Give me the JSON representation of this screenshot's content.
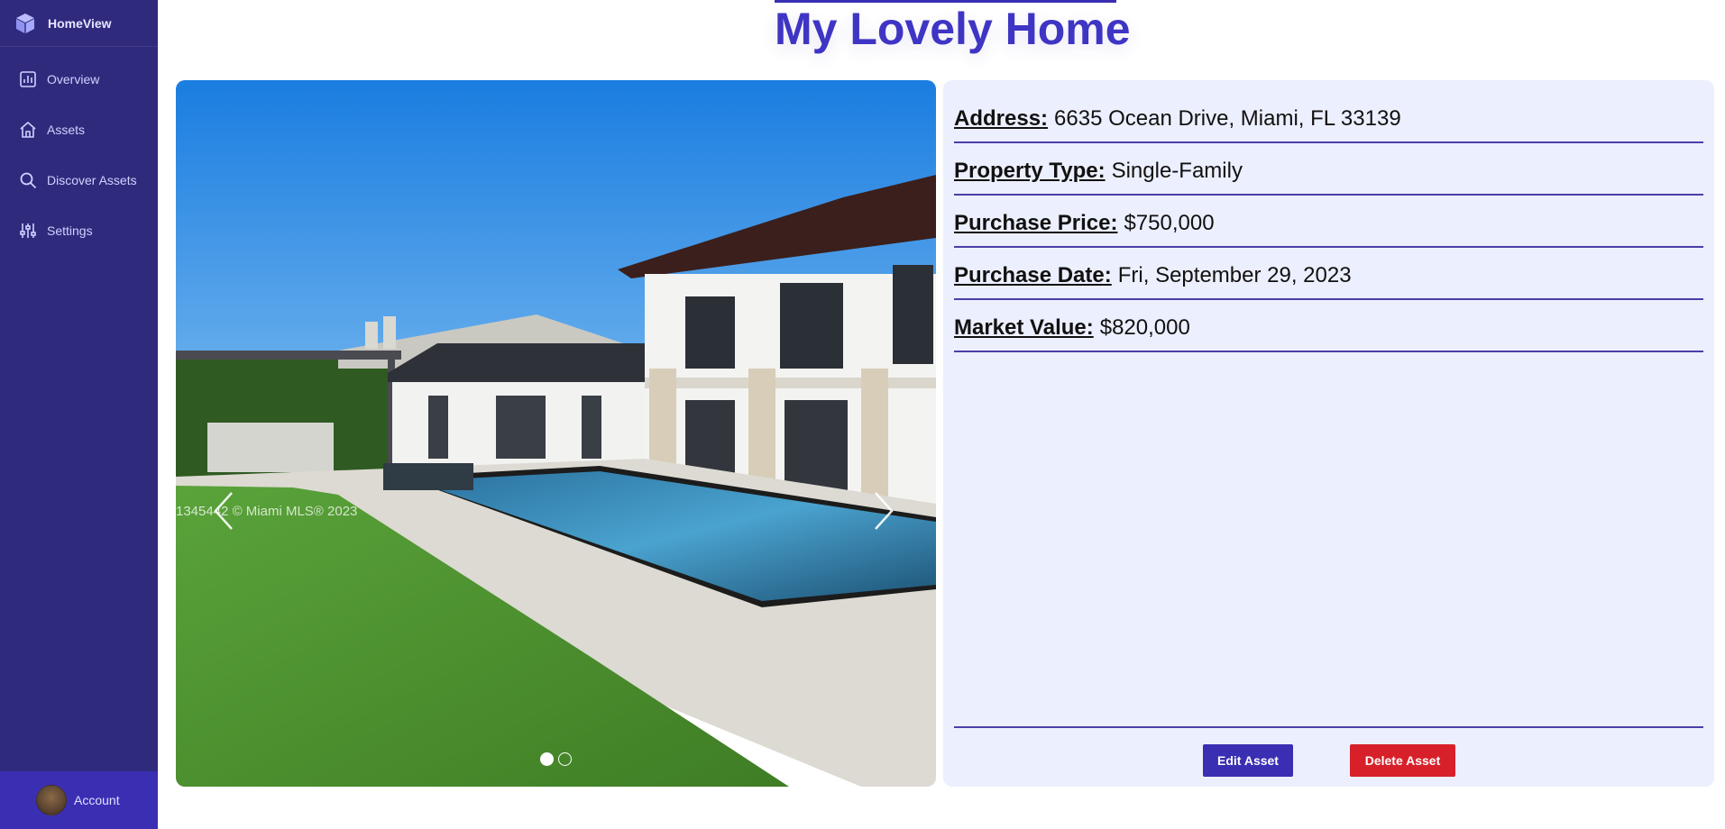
{
  "app": {
    "name": "HomeView"
  },
  "sidebar": {
    "items": [
      {
        "label": "Overview",
        "icon": "chart-icon"
      },
      {
        "label": "Assets",
        "icon": "home-icon"
      },
      {
        "label": "Discover Assets",
        "icon": "search-icon"
      },
      {
        "label": "Settings",
        "icon": "sliders-icon"
      }
    ],
    "account": {
      "label": "Account"
    }
  },
  "page": {
    "title": "My Lovely Home"
  },
  "carousel": {
    "watermark": "1345442 © Miami MLS® 2023",
    "slide_count": 2,
    "active_slide": 1
  },
  "details": {
    "fields": [
      {
        "key": "Address:",
        "value": "6635 Ocean Drive, Miami, FL 33139"
      },
      {
        "key": "Property Type:",
        "value": "Single-Family"
      },
      {
        "key": "Purchase Price:",
        "value": "$750,000"
      },
      {
        "key": "Purchase Date:",
        "value": "Fri, September 29, 2023"
      },
      {
        "key": "Market Value:",
        "value": "$820,000"
      }
    ],
    "edit_label": "Edit Asset",
    "delete_label": "Delete Asset"
  },
  "colors": {
    "sidebar_bg": "#302a7d",
    "accent": "#3a2fb2",
    "title": "#3f35c4",
    "panel_bg": "#eceffd",
    "danger": "#d7202a"
  }
}
